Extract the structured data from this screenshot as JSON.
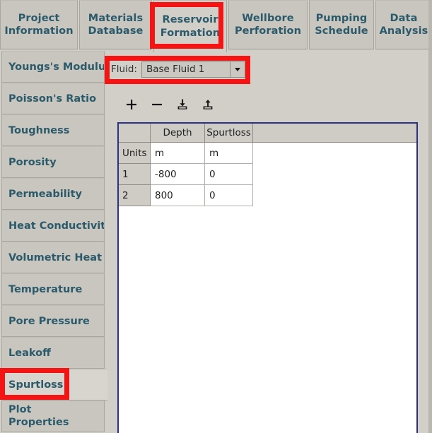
{
  "app": {
    "accent_red": "#f41414",
    "tab_text_color": "#2b5a6b",
    "panel_bg": "#d2cfc8",
    "grid_border_color": "#2c3087"
  },
  "top_tabs": [
    {
      "label": "Project\nInformation",
      "active": false
    },
    {
      "label": "Materials\nDatabase",
      "active": false
    },
    {
      "label": "Reservoir\nFormation",
      "active": true
    },
    {
      "label": "Wellbore\nPerforation",
      "active": false
    },
    {
      "label": "Pumping\nSchedule",
      "active": false
    },
    {
      "label": "Data\nAnalysis",
      "active": false
    }
  ],
  "sidebar": {
    "items": [
      {
        "label": "Youngs's Modulus",
        "active": false
      },
      {
        "label": "Poisson's Ratio",
        "active": false
      },
      {
        "label": "Toughness",
        "active": false
      },
      {
        "label": "Porosity",
        "active": false
      },
      {
        "label": "Permeability",
        "active": false
      },
      {
        "label": "Heat Conductivity",
        "active": false
      },
      {
        "label": "Volumetric Heat C",
        "active": false
      },
      {
        "label": "Temperature",
        "active": false
      },
      {
        "label": "Pore Pressure",
        "active": false
      },
      {
        "label": "Leakoff",
        "active": false
      },
      {
        "label": "Spurtloss",
        "active": true
      },
      {
        "label": "Plot\nProperties",
        "active": false
      }
    ]
  },
  "fluid_selector": {
    "label": "Fluid:",
    "value": "Base Fluid 1",
    "arrow_icon": "chevron-down-icon"
  },
  "toolbar": {
    "buttons": [
      {
        "name": "add-row-button",
        "icon": "plus-icon",
        "label": "+"
      },
      {
        "name": "remove-row-button",
        "icon": "minus-icon",
        "label": "−"
      },
      {
        "name": "import-button",
        "icon": "download-icon",
        "label": ""
      },
      {
        "name": "export-button",
        "icon": "upload-icon",
        "label": ""
      }
    ]
  },
  "table": {
    "corner_header": "",
    "columns": [
      "Depth",
      "Spurtloss"
    ],
    "rows": [
      {
        "header": "Units",
        "cells": [
          "m",
          "m"
        ]
      },
      {
        "header": "1",
        "cells": [
          "-800",
          "0"
        ]
      },
      {
        "header": "2",
        "cells": [
          "800",
          "0"
        ]
      }
    ]
  }
}
